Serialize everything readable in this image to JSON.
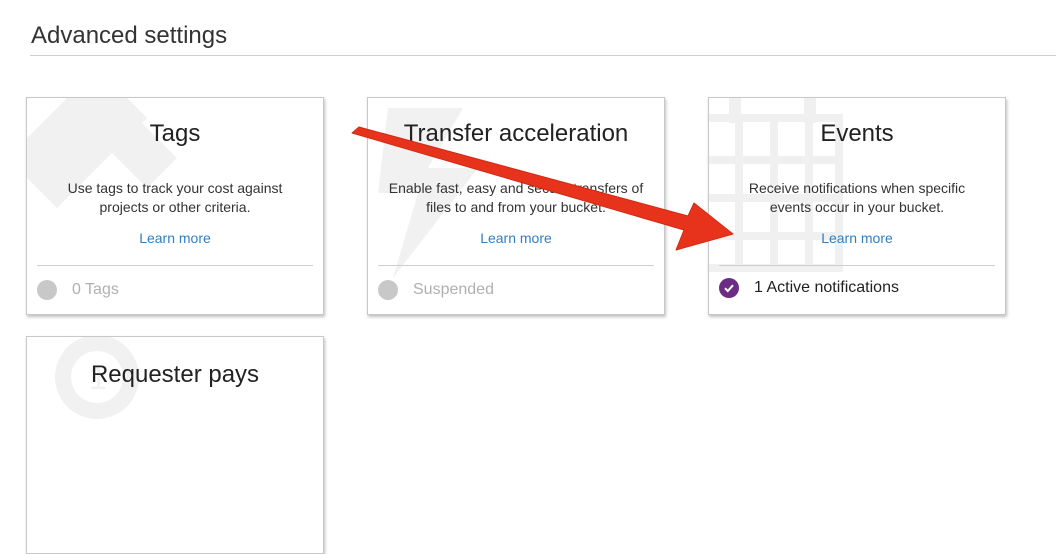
{
  "section": {
    "title": "Advanced settings"
  },
  "cards": [
    {
      "title": "Tags",
      "description": "Use tags to track your cost against projects or other criteria.",
      "learn_more": "Learn more",
      "status": "0 Tags",
      "active": false,
      "icon": "tag-icon"
    },
    {
      "title": "Transfer acceleration",
      "description": "Enable fast, easy and secure transfers of files to and from your bucket.",
      "learn_more": "Learn more",
      "status": "Suspended",
      "active": false,
      "icon": "lightning-icon"
    },
    {
      "title": "Events",
      "description": "Receive notifications when specific events occur in your bucket.",
      "learn_more": "Learn more",
      "status": "1 Active notifications",
      "active": true,
      "icon": "calendar-icon"
    },
    {
      "title": "Requester pays",
      "icon": "coin-icon"
    }
  ],
  "colors": {
    "accent_link": "#2f7fc1",
    "active_status": "#6b2d84",
    "inactive_status": "#c8c8c8",
    "annotation_arrow": "#e8331c"
  }
}
